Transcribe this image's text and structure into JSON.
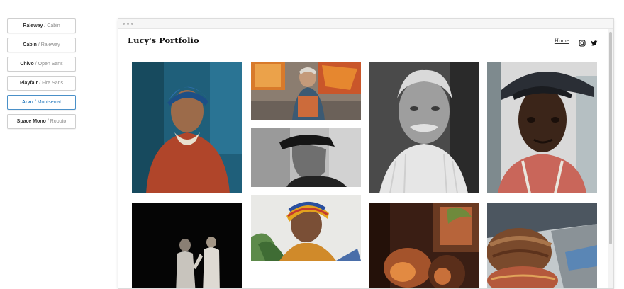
{
  "font_pairs": [
    {
      "heading": "Raleway",
      "body": "Cabin",
      "active": false
    },
    {
      "heading": "Cabin",
      "body": "Raleway",
      "active": false
    },
    {
      "heading": "Chivo",
      "body": "Open Sans",
      "active": false
    },
    {
      "heading": "Playfair",
      "body": "Fira Sans",
      "active": false
    },
    {
      "heading": "Arvo",
      "body": "Montserrat",
      "active": true
    },
    {
      "heading": "Space Mono",
      "body": "Roboto",
      "active": false
    }
  ],
  "separator": "/",
  "site": {
    "title": "Lucy's Portfolio",
    "nav_home": "Home",
    "icons": [
      "instagram-icon",
      "twitter-icon"
    ]
  },
  "colors": {
    "active_accent": "#2f7fbf",
    "link": "#333333"
  },
  "gallery": [
    {
      "name": "photo-woman-headscarf-blue-wall"
    },
    {
      "name": "photo-painter-studio"
    },
    {
      "name": "photo-man-white-hair-mustache"
    },
    {
      "name": "photo-young-man-cap"
    },
    {
      "name": "photo-man-cap-bw"
    },
    {
      "name": "photo-two-men-dark-stage"
    },
    {
      "name": "photo-woman-colorful-headwrap"
    },
    {
      "name": "photo-warm-interior-chairs"
    },
    {
      "name": "photo-market-baskets"
    }
  ]
}
